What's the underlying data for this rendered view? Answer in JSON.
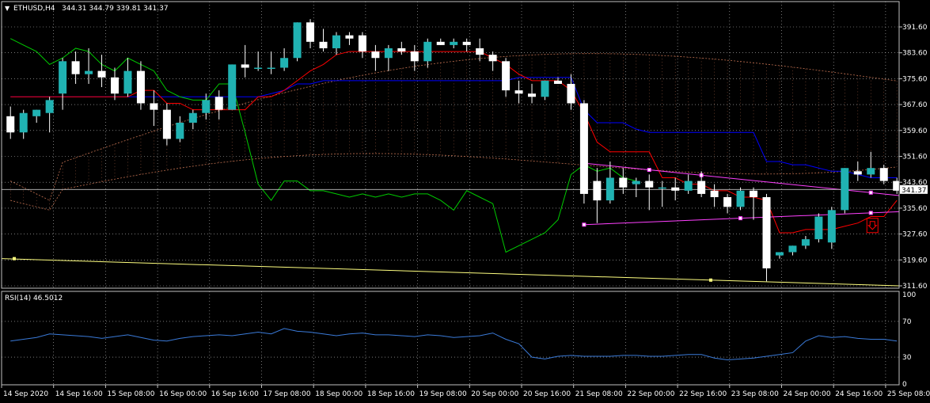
{
  "header": {
    "symbol": "ETHUSD,H4",
    "ohlc": "344.31 344.79 339.81 341.37",
    "indicator": "RSI(14) 46.5012"
  },
  "colors": {
    "background": "#000000",
    "grid": "#c0c0c0",
    "bull_candle": "#20b2b2",
    "bear_candle": "#ffffff",
    "tenkan": "#ff0000",
    "kijun": "#0000ff",
    "chikou": "#00cc00",
    "cloud": "#c07050",
    "trendline": "#ff40ff",
    "ma": "#ffff80",
    "rsi": "#3a7ad8",
    "signal": "#ff0000"
  },
  "icons": {
    "signal": "arrow-down-signal-icon"
  },
  "price_axis": {
    "labels": [
      "391.60",
      "383.60",
      "375.60",
      "367.60",
      "359.60",
      "351.60",
      "343.60",
      "335.60",
      "327.60",
      "319.60",
      "311.60"
    ],
    "current_price": "341.37"
  },
  "rsi_axis": {
    "labels": [
      "100",
      "70",
      "30",
      "0"
    ]
  },
  "time_axis": {
    "labels": [
      "14 Sep 2020",
      "14 Sep 16:00",
      "15 Sep 08:00",
      "16 Sep 00:00",
      "16 Sep 16:00",
      "17 Sep 08:00",
      "18 Sep 00:00",
      "18 Sep 16:00",
      "19 Sep 08:00",
      "20 Sep 00:00",
      "20 Sep 16:00",
      "21 Sep 08:00",
      "22 Sep 00:00",
      "22 Sep 16:00",
      "23 Sep 08:00",
      "24 Sep 00:00",
      "24 Sep 16:00",
      "25 Sep 08:00"
    ]
  },
  "chart_data": {
    "type": "candlestick",
    "symbol": "ETHUSD",
    "timeframe": "H4",
    "ylim": [
      311.6,
      395.0
    ],
    "candles": [
      {
        "o": 364,
        "h": 367,
        "c": 359,
        "l": 357
      },
      {
        "o": 359,
        "h": 366,
        "c": 365,
        "l": 357
      },
      {
        "o": 364,
        "h": 366,
        "c": 366,
        "l": 362
      },
      {
        "o": 365,
        "h": 370,
        "c": 369,
        "l": 359
      },
      {
        "o": 371,
        "h": 382,
        "c": 381,
        "l": 366
      },
      {
        "o": 381,
        "h": 384,
        "c": 377,
        "l": 374
      },
      {
        "o": 377,
        "h": 385,
        "c": 378,
        "l": 374
      },
      {
        "o": 378,
        "h": 383,
        "c": 376,
        "l": 373
      },
      {
        "o": 376,
        "h": 379,
        "c": 371,
        "l": 369
      },
      {
        "o": 371,
        "h": 382,
        "c": 378,
        "l": 370
      },
      {
        "o": 378,
        "h": 381,
        "c": 368,
        "l": 366
      },
      {
        "o": 368,
        "h": 372,
        "c": 366,
        "l": 361
      },
      {
        "o": 366,
        "h": 368,
        "c": 357,
        "l": 355
      },
      {
        "o": 357,
        "h": 364,
        "c": 362,
        "l": 356
      },
      {
        "o": 362,
        "h": 366,
        "c": 365,
        "l": 360
      },
      {
        "o": 365,
        "h": 371,
        "c": 369,
        "l": 363
      },
      {
        "o": 370,
        "h": 372,
        "c": 366,
        "l": 363
      },
      {
        "o": 366,
        "h": 380,
        "c": 380,
        "l": 366
      },
      {
        "o": 380,
        "h": 386,
        "c": 379,
        "l": 376
      },
      {
        "o": 379,
        "h": 384,
        "c": 379,
        "l": 378
      },
      {
        "o": 379,
        "h": 384,
        "c": 379,
        "l": 377
      },
      {
        "o": 379,
        "h": 385,
        "c": 382,
        "l": 378
      },
      {
        "o": 382,
        "h": 393,
        "c": 393,
        "l": 381
      },
      {
        "o": 393,
        "h": 394,
        "c": 387,
        "l": 385
      },
      {
        "o": 387,
        "h": 391,
        "c": 385,
        "l": 384
      },
      {
        "o": 385,
        "h": 390,
        "c": 389,
        "l": 383
      },
      {
        "o": 389,
        "h": 390,
        "c": 388,
        "l": 386
      },
      {
        "o": 389,
        "h": 390,
        "c": 384,
        "l": 382
      },
      {
        "o": 384,
        "h": 386,
        "c": 382,
        "l": 378
      },
      {
        "o": 382,
        "h": 386,
        "c": 385,
        "l": 378
      },
      {
        "o": 385,
        "h": 387,
        "c": 384,
        "l": 383
      },
      {
        "o": 384,
        "h": 386,
        "c": 381,
        "l": 378
      },
      {
        "o": 381,
        "h": 388,
        "c": 387,
        "l": 379
      },
      {
        "o": 387,
        "h": 388,
        "c": 386,
        "l": 386
      },
      {
        "o": 386,
        "h": 388,
        "c": 387,
        "l": 385
      },
      {
        "o": 387,
        "h": 388,
        "c": 386,
        "l": 384
      },
      {
        "o": 385,
        "h": 388,
        "c": 383,
        "l": 381
      },
      {
        "o": 383,
        "h": 384,
        "c": 381,
        "l": 378
      },
      {
        "o": 381,
        "h": 382,
        "c": 372,
        "l": 370
      },
      {
        "o": 372,
        "h": 375,
        "c": 371,
        "l": 368
      },
      {
        "o": 371,
        "h": 374,
        "c": 370,
        "l": 368
      },
      {
        "o": 370,
        "h": 375,
        "c": 375,
        "l": 369
      },
      {
        "o": 375,
        "h": 376,
        "c": 374,
        "l": 374
      },
      {
        "o": 374,
        "h": 377,
        "c": 368,
        "l": 366
      },
      {
        "o": 368,
        "h": 369,
        "c": 340,
        "l": 337
      },
      {
        "o": 344,
        "h": 348,
        "c": 338,
        "l": 331
      },
      {
        "o": 338,
        "h": 350,
        "c": 345,
        "l": 337
      },
      {
        "o": 345,
        "h": 348,
        "c": 342,
        "l": 340
      },
      {
        "o": 343,
        "h": 345,
        "c": 344,
        "l": 339
      },
      {
        "o": 344,
        "h": 346,
        "c": 342,
        "l": 335
      },
      {
        "o": 342,
        "h": 344,
        "c": 342,
        "l": 336
      },
      {
        "o": 342,
        "h": 345,
        "c": 341,
        "l": 338
      },
      {
        "o": 341,
        "h": 346,
        "c": 344,
        "l": 340
      },
      {
        "o": 344,
        "h": 347,
        "c": 340,
        "l": 339
      },
      {
        "o": 341,
        "h": 343,
        "c": 339,
        "l": 336
      },
      {
        "o": 339,
        "h": 340,
        "c": 336,
        "l": 334
      },
      {
        "o": 336,
        "h": 342,
        "c": 341,
        "l": 335
      },
      {
        "o": 341,
        "h": 342,
        "c": 339,
        "l": 332
      },
      {
        "o": 339,
        "h": 340,
        "c": 317,
        "l": 313
      },
      {
        "o": 321,
        "h": 322,
        "c": 322,
        "l": 320
      },
      {
        "o": 322,
        "h": 324,
        "c": 324,
        "l": 321
      },
      {
        "o": 324,
        "h": 327,
        "c": 326,
        "l": 323
      },
      {
        "o": 326,
        "h": 334,
        "c": 333,
        "l": 325
      },
      {
        "o": 325,
        "h": 336,
        "c": 335,
        "l": 323
      },
      {
        "o": 335,
        "h": 348,
        "c": 348,
        "l": 334
      },
      {
        "o": 347,
        "h": 350,
        "c": 346,
        "l": 344
      },
      {
        "o": 346,
        "h": 353,
        "c": 348,
        "l": 345
      },
      {
        "o": 348,
        "h": 349,
        "c": 344,
        "l": 343
      },
      {
        "o": 344,
        "h": 345,
        "c": 341,
        "l": 340
      }
    ],
    "tenkan_sen": [
      370,
      370,
      370,
      370,
      370,
      370,
      370,
      370,
      370,
      370,
      372,
      372,
      368,
      368,
      366,
      366,
      366,
      366,
      366,
      370,
      370,
      372,
      375,
      378,
      380,
      383,
      384,
      384,
      384,
      384,
      384,
      384,
      384,
      384,
      384,
      384,
      384,
      382,
      380,
      377,
      375,
      375,
      375,
      372,
      365,
      356,
      353,
      353,
      353,
      353,
      345,
      345,
      343,
      343,
      341,
      341,
      339,
      339,
      338,
      328,
      328,
      329,
      329,
      329,
      330,
      331,
      333,
      333,
      338
    ],
    "kijun_sen": [
      370,
      370,
      370,
      370,
      370,
      370,
      370,
      370,
      370,
      370,
      370,
      370,
      370,
      370,
      370,
      370,
      370,
      370,
      370,
      370,
      371,
      372,
      374,
      374,
      375,
      375,
      375,
      375,
      375,
      375,
      375,
      375,
      375,
      375,
      375,
      375,
      375,
      375,
      375,
      376,
      376,
      376,
      376,
      376,
      366,
      362,
      362,
      362,
      360,
      359,
      359,
      359,
      359,
      359,
      359,
      359,
      359,
      359,
      350,
      350,
      349,
      349,
      348,
      347,
      347,
      346,
      345,
      345,
      345
    ],
    "chikou_span": [
      388,
      386,
      384,
      380,
      382,
      385,
      384,
      380,
      378,
      382,
      380,
      378,
      372,
      370,
      369,
      369,
      374,
      374,
      359,
      343,
      338,
      344,
      344,
      341,
      341,
      340,
      339,
      340,
      339,
      340,
      339,
      340,
      340,
      338,
      335,
      341,
      339,
      337,
      322,
      324,
      326,
      328,
      332,
      346,
      349,
      347,
      348,
      345,
      344
    ],
    "rsi": [
      48,
      50,
      52,
      56,
      55,
      54,
      53,
      51,
      53,
      55,
      52,
      49,
      48,
      51,
      53,
      54,
      55,
      54,
      56,
      58,
      56,
      62,
      59,
      58,
      56,
      54,
      56,
      57,
      55,
      55,
      54,
      53,
      55,
      54,
      52,
      53,
      54,
      57,
      50,
      45,
      30,
      28,
      31,
      32,
      31,
      31,
      31,
      32,
      32,
      31,
      31,
      32,
      33,
      33,
      29,
      27,
      28,
      29,
      31,
      33,
      35,
      48,
      54,
      52,
      53,
      51,
      50,
      50,
      48
    ],
    "ma": [
      320,
      311.6
    ],
    "trendline_upper": [
      349.5,
      339.5
    ],
    "trendline_lower": [
      330.5,
      334.5
    ],
    "signal": {
      "type": "sell-arrow",
      "price": 330
    }
  }
}
